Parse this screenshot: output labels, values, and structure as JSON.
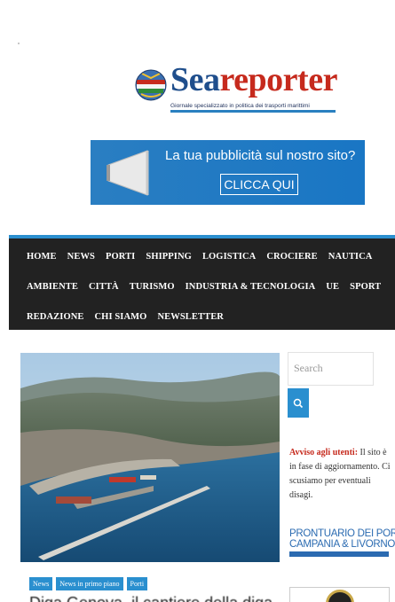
{
  "header": {
    "logo": {
      "name_part1": "Sea",
      "name_part2": "reporter",
      "subtitle": "Giornale specializzato in politica dei trasporti marittimi"
    }
  },
  "ad_banner": {
    "text": "La tua pubblicità sul nostro sito?",
    "button": "CLICCA QUI"
  },
  "nav": {
    "row1": [
      "HOME",
      "NEWS",
      "PORTI",
      "SHIPPING",
      "LOGISTICA",
      "CROCIERE",
      "NAUTICA"
    ],
    "row2": [
      "AMBIENTE",
      "CITTÀ",
      "TURISMO",
      "INDUSTRIA & TECNOLOGIA",
      "UE",
      "SPORT"
    ],
    "row3": [
      "REDAZIONE",
      "CHI SIAMO",
      "NEWSLETTER"
    ]
  },
  "article": {
    "tags": [
      "News",
      "News in primo piano",
      "Porti"
    ],
    "headline": "Diga Genova, il cantiere della diga"
  },
  "sidebar": {
    "search_placeholder": "Search",
    "notice_label": "Avviso agli utenti:",
    "notice_text": "Il sito è in fase di aggiornamento. Ci scusiamo per eventuali disagi.",
    "prontuario_line1": "PRONTUARIO DEI PORTI",
    "prontuario_line2": "CAMPANIA & LIVORNO"
  },
  "colors": {
    "accent": "#2a8fcf",
    "nav_bg": "#222222",
    "brand_red": "#c62a1d",
    "brand_blue": "#1f4e8c"
  }
}
